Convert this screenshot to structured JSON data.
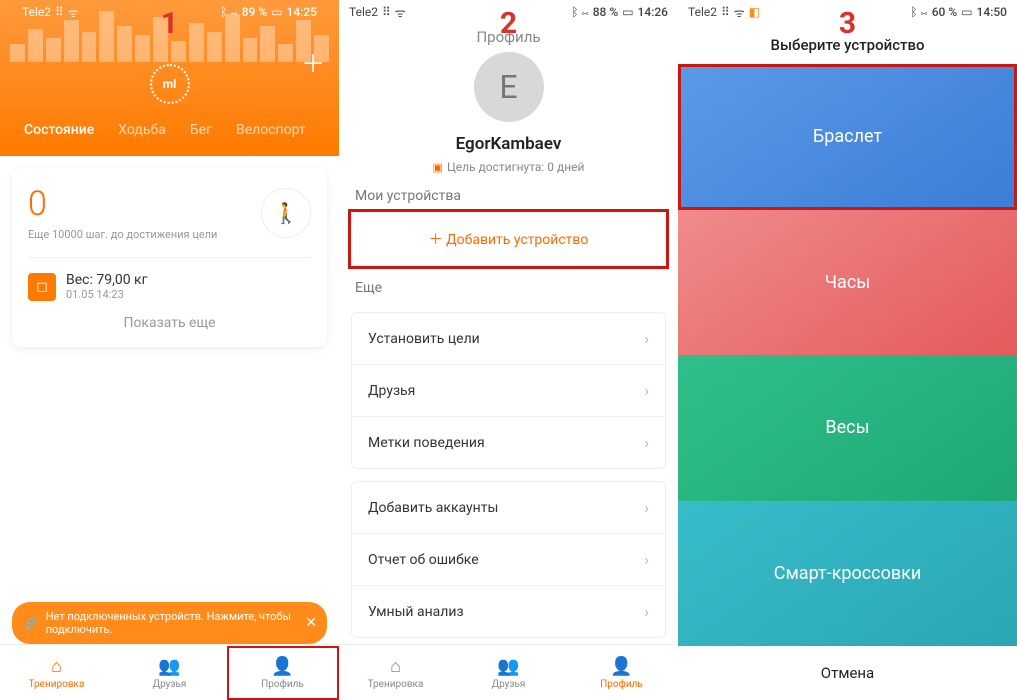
{
  "screens": {
    "s1": {
      "number": "1",
      "status": {
        "carrier": "Tele2",
        "signal": "⠿",
        "wifi": "ᯤ",
        "nfc": "ᛒ ⋈",
        "battery": "89 %",
        "batt_icon": "▭",
        "time": "14:25"
      },
      "plus": "＋",
      "logo": "ml",
      "tabs": [
        "Состояние",
        "Ходьба",
        "Бег",
        "Велоспорт"
      ],
      "steps": {
        "value": "0",
        "sub": "Еще 10000 шаг. до достижения цели",
        "walker": "🚶"
      },
      "weight": {
        "icon": "◻",
        "label": "Вес: 79,00  кг",
        "date": "01.05 14:23"
      },
      "showmore": "Показать еще",
      "banner": {
        "icon": "🔗",
        "text": "Нет подключенных устройств. Нажмите, чтобы подключить.",
        "close": "✕"
      },
      "nav": [
        {
          "icon": "⌂",
          "label": "Тренировка"
        },
        {
          "icon": "👥",
          "label": "Друзья"
        },
        {
          "icon": "👤",
          "label": "Профиль"
        }
      ]
    },
    "s2": {
      "number": "2",
      "status": {
        "carrier": "Tele2",
        "signal": "⠿",
        "wifi": "ᯤ",
        "nfc": "ᛒ ⋈",
        "battery": "88 %",
        "batt_icon": "▭",
        "time": "14:26"
      },
      "title": "Профиль",
      "avatar_letter": "E",
      "username": "EgorKambaev",
      "goal": {
        "icon": "▣",
        "text": "Цель достигнута: 0 дней"
      },
      "devices_label": "Мои устройства",
      "add_device": "＋ Добавить устройство",
      "more_label": "Еще",
      "items1": [
        "Установить цели",
        "Друзья",
        "Метки поведения"
      ],
      "items2": [
        "Добавить аккаунты",
        "Отчет об ошибке",
        "Умный анализ"
      ],
      "nav": [
        {
          "icon": "⌂",
          "label": "Тренировка"
        },
        {
          "icon": "👥",
          "label": "Друзья"
        },
        {
          "icon": "👤",
          "label": "Профиль"
        }
      ]
    },
    "s3": {
      "number": "3",
      "status": {
        "carrier": "Tele2",
        "signal": "⠿",
        "wifi": "ᯤ",
        "extra": "◧",
        "nfc": "ᛒ ⋈",
        "battery": "60 %",
        "batt_icon": "▭",
        "time": "14:50"
      },
      "title": "Выберите устройство",
      "tiles": [
        "Браслет",
        "Часы",
        "Весы",
        "Смарт-кроссовки"
      ],
      "cancel": "Отмена"
    }
  }
}
